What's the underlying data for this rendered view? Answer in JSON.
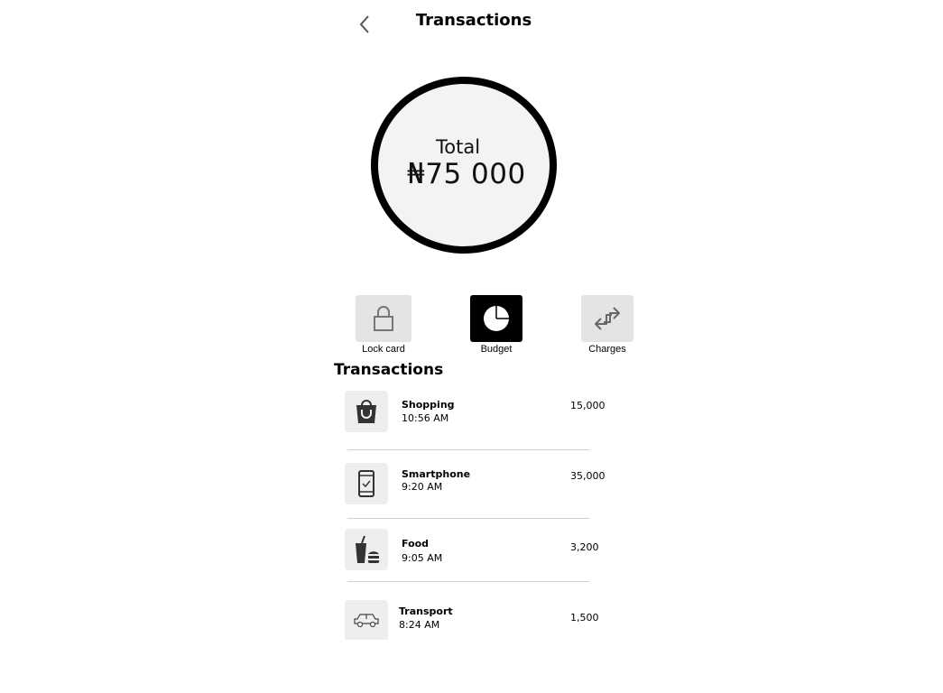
{
  "header": {
    "title": "Transactions"
  },
  "balance": {
    "label": "Total",
    "amount": "₦75 000"
  },
  "actions": [
    {
      "label": "Lock card",
      "icon": "lock-icon"
    },
    {
      "label": "Budget",
      "icon": "pie-chart-icon"
    },
    {
      "label": "Charges",
      "icon": "arrows-swap-icon"
    }
  ],
  "section_title": "Transactions",
  "transactions": [
    {
      "name": "Shopping",
      "time": "10:56 AM",
      "amount": "15,000",
      "icon": "shopping-bag-icon"
    },
    {
      "name": "Smartphone",
      "time": "9:20 AM",
      "amount": "35,000",
      "icon": "smartphone-icon"
    },
    {
      "name": "Food",
      "time": "9:05 AM",
      "amount": "3,200",
      "icon": "food-drink-icon"
    },
    {
      "name": "Transport",
      "time": "8:24 AM",
      "amount": "1,500",
      "icon": "car-icon"
    }
  ]
}
